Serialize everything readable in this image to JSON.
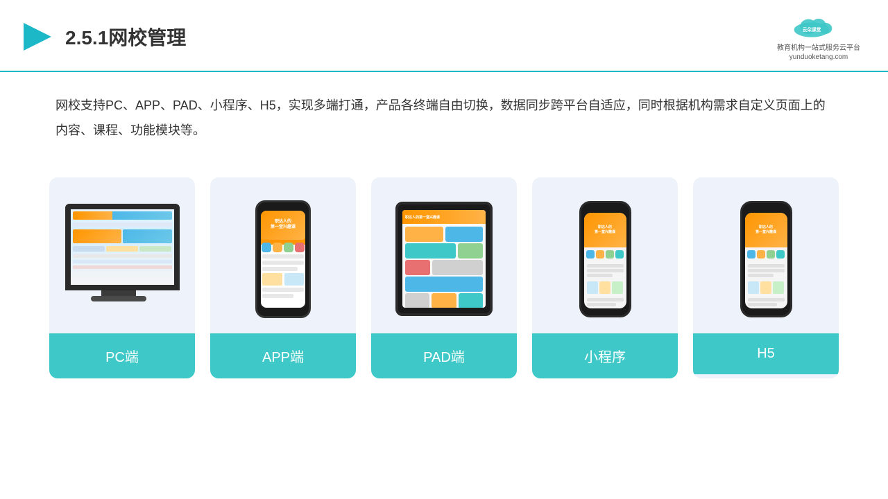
{
  "header": {
    "title": "2.5.1网校管理",
    "logo_name": "云朵课堂",
    "logo_sub": "yunduoketang.com",
    "logo_tagline": "教育机构一站\n式服务云平台"
  },
  "description": {
    "text": "网校支持PC、APP、PAD、小程序、H5，实现多端打通，产品各终端自由切换，数据同步跨平台自适应，同时根据机构需求自定义页面上的内容、课程、功能模块等。"
  },
  "cards": [
    {
      "id": "pc",
      "label": "PC端"
    },
    {
      "id": "app",
      "label": "APP端"
    },
    {
      "id": "pad",
      "label": "PAD端"
    },
    {
      "id": "miniprogram",
      "label": "小程序"
    },
    {
      "id": "h5",
      "label": "H5"
    }
  ],
  "colors": {
    "accent": "#3ec8c8",
    "header_line": "#1cb8c8",
    "card_bg": "#eef2fa",
    "label_bg": "#3ec8c8",
    "text_dark": "#333333",
    "text_white": "#ffffff"
  }
}
